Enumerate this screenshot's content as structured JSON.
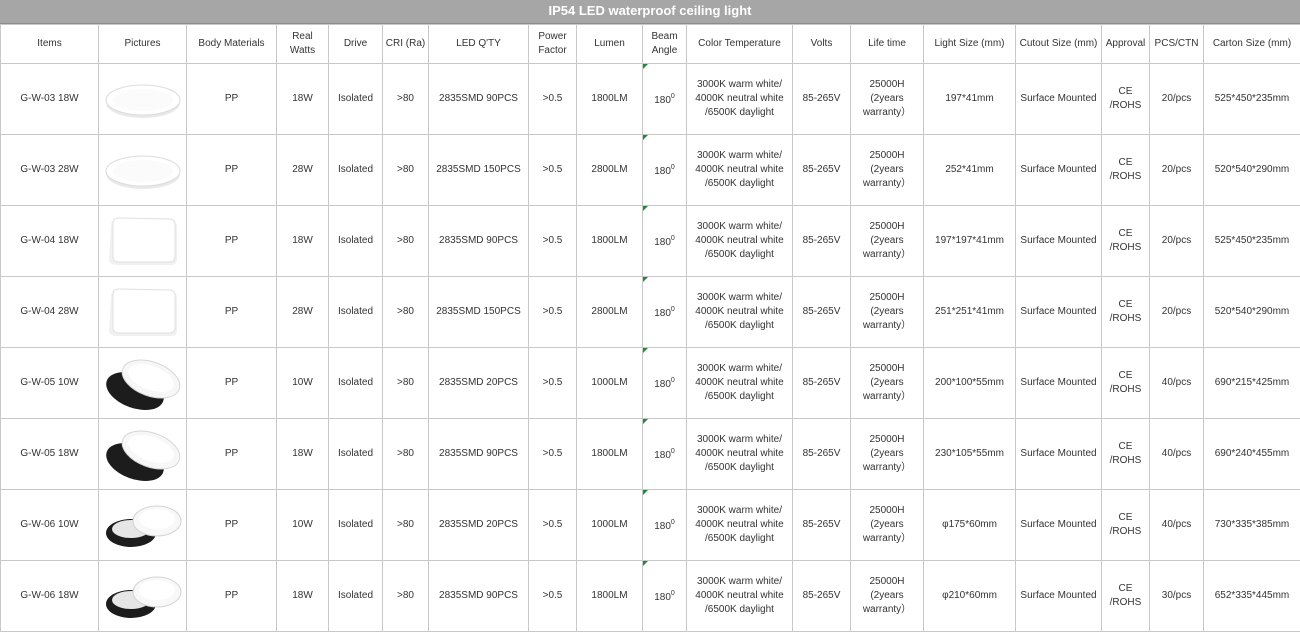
{
  "title": "IP54 LED waterproof ceiling light",
  "headers": [
    "Items",
    "Pictures",
    "Body Materials",
    "Real Watts",
    "Drive",
    "CRI (Ra)",
    "LED Q'TY",
    "Power Factor",
    "Lumen",
    "Beam Angle",
    "Color Temperature",
    "Volts",
    "Life time",
    "Light Size (mm)",
    "Cutout Size (mm)",
    "Approval",
    "PCS/CTN",
    "Carton Size (mm)"
  ],
  "rows": [
    {
      "item": "G-W-03 18W",
      "picture": "round-flat-lamp-icon",
      "material": "PP",
      "watts": "18W",
      "drive": "Isolated",
      "cri": ">80",
      "led": "2835SMD  90PCS",
      "pf": ">0.5",
      "lumen": "1800LM",
      "beam": "180",
      "color": "3000K warm white/ 4000K neutral white /6500K daylight",
      "volts": "85-265V",
      "life": "25000H (2years warranty）",
      "size": "197*41mm",
      "cutout": "Surface Mounted",
      "approval": "CE /ROHS",
      "pcs": "20/pcs",
      "carton": "525*450*235mm"
    },
    {
      "item": "G-W-03 28W",
      "picture": "round-flat-lamp-icon",
      "material": "PP",
      "watts": "28W",
      "drive": "Isolated",
      "cri": ">80",
      "led": "2835SMD  150PCS",
      "pf": ">0.5",
      "lumen": "2800LM",
      "beam": "180",
      "color": "3000K warm white/ 4000K neutral white /6500K daylight",
      "volts": "85-265V",
      "life": "25000H (2years warranty）",
      "size": "252*41mm",
      "cutout": "Surface Mounted",
      "approval": "CE /ROHS",
      "pcs": "20/pcs",
      "carton": "520*540*290mm"
    },
    {
      "item": "G-W-04 18W",
      "picture": "square-flat-lamp-icon",
      "material": "PP",
      "watts": "18W",
      "drive": "Isolated",
      "cri": ">80",
      "led": "2835SMD  90PCS",
      "pf": ">0.5",
      "lumen": "1800LM",
      "beam": "180",
      "color": "3000K warm white/ 4000K neutral white /6500K daylight",
      "volts": "85-265V",
      "life": "25000H (2years warranty）",
      "size": "197*197*41mm",
      "cutout": "Surface Mounted",
      "approval": "CE /ROHS",
      "pcs": "20/pcs",
      "carton": "525*450*235mm"
    },
    {
      "item": "G-W-04 28W",
      "picture": "square-flat-lamp-icon",
      "material": "PP",
      "watts": "28W",
      "drive": "Isolated",
      "cri": ">80",
      "led": "2835SMD 150PCS",
      "pf": ">0.5",
      "lumen": "2800LM",
      "beam": "180",
      "color": "3000K warm white/ 4000K neutral white /6500K daylight",
      "volts": "85-265V",
      "life": "25000H (2years warranty）",
      "size": "251*251*41mm",
      "cutout": "Surface Mounted",
      "approval": "CE /ROHS",
      "pcs": "20/pcs",
      "carton": "520*540*290mm"
    },
    {
      "item": "G-W-05 10W",
      "picture": "oval-bulkhead-lamp-icon",
      "material": "PP",
      "watts": "10W",
      "drive": "Isolated",
      "cri": ">80",
      "led": "2835SMD 20PCS",
      "pf": ">0.5",
      "lumen": "1000LM",
      "beam": "180",
      "color": "3000K warm white/ 4000K neutral white /6500K daylight",
      "volts": "85-265V",
      "life": "25000H (2years warranty）",
      "size": "200*100*55mm",
      "cutout": "Surface Mounted",
      "approval": "CE /ROHS",
      "pcs": "40/pcs",
      "carton": "690*215*425mm"
    },
    {
      "item": "G-W-05 18W",
      "picture": "oval-bulkhead-lamp-icon",
      "material": "PP",
      "watts": "18W",
      "drive": "Isolated",
      "cri": ">80",
      "led": "2835SMD  90PCS",
      "pf": ">0.5",
      "lumen": "1800LM",
      "beam": "180",
      "color": "3000K warm white/ 4000K neutral white /6500K daylight",
      "volts": "85-265V",
      "life": "25000H (2years warranty）",
      "size": "230*105*55mm",
      "cutout": "Surface Mounted",
      "approval": "CE /ROHS",
      "pcs": "40/pcs",
      "carton": "690*240*455mm"
    },
    {
      "item": "G-W-06 10W",
      "picture": "round-bulkhead-lamp-icon",
      "material": "PP",
      "watts": "10W",
      "drive": "Isolated",
      "cri": ">80",
      "led": "2835SMD  20PCS",
      "pf": ">0.5",
      "lumen": "1000LM",
      "beam": "180",
      "color": "3000K warm white/ 4000K neutral white /6500K daylight",
      "volts": "85-265V",
      "life": "25000H (2years warranty）",
      "size": "φ175*60mm",
      "cutout": "Surface Mounted",
      "approval": "CE /ROHS",
      "pcs": "40/pcs",
      "carton": "730*335*385mm"
    },
    {
      "item": "G-W-06 18W",
      "picture": "round-bulkhead-lamp-icon",
      "material": "PP",
      "watts": "18W",
      "drive": "Isolated",
      "cri": ">80",
      "led": "2835SMD  90PCS",
      "pf": ">0.5",
      "lumen": "1800LM",
      "beam": "180",
      "color": "3000K warm white/ 4000K neutral white /6500K daylight",
      "volts": "85-265V",
      "life": "25000H (2years warranty）",
      "size": "φ210*60mm",
      "cutout": "Surface Mounted",
      "approval": "CE /ROHS",
      "pcs": "30/pcs",
      "carton": "652*335*445mm"
    }
  ],
  "colors": {
    "title_bg": "#a6a6a6",
    "border": "#c8c8c8",
    "text": "#333333",
    "corner_mark": "#1f8a3a"
  }
}
